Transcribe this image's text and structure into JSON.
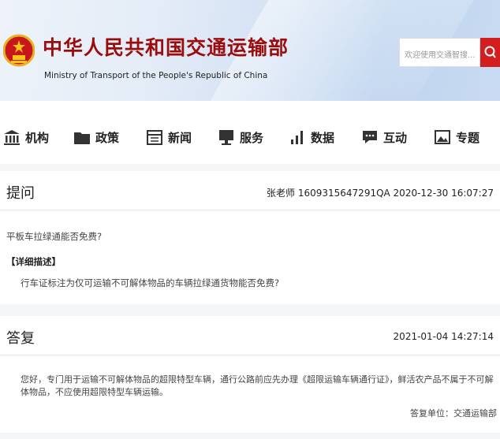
{
  "site": {
    "title_cn": "中华人民共和国交通运输部",
    "title_en": "Ministry of Transport of the People's Republic of China",
    "search_placeholder": "欢迎使用交通智搜..."
  },
  "nav": {
    "items": [
      {
        "label": "机构",
        "icon": "building-icon"
      },
      {
        "label": "政策",
        "icon": "folder-icon"
      },
      {
        "label": "新闻",
        "icon": "calendar-icon"
      },
      {
        "label": "服务",
        "icon": "monitor-icon"
      },
      {
        "label": "数据",
        "icon": "bar-chart-icon"
      },
      {
        "label": "互动",
        "icon": "chat-icon"
      },
      {
        "label": "专题",
        "icon": "image-icon"
      }
    ]
  },
  "question": {
    "heading": "提问",
    "meta": "张老师 1609315647291QA  2020-12-30 16:07:27",
    "text": "平板车拉绿通能否免费?",
    "detail_label": "【详细描述】",
    "detail": "行车证标注为仅可运输不可解体物品的车辆拉绿通货物能否免费?"
  },
  "answer": {
    "heading": "答复",
    "date": "2021-01-04 14:27:14",
    "text": "您好，专门用于运输不可解体物品的超限特型车辆，通行公路前应先办理《超限运输车辆通行证》，鲜活农产品不属于不可解体物品，不应使用超限特型车辆运输。",
    "unit": "答复单位：交通运输部"
  },
  "colors": {
    "brand_red": "#9b0d0d",
    "search_red": "#d21e1e"
  }
}
